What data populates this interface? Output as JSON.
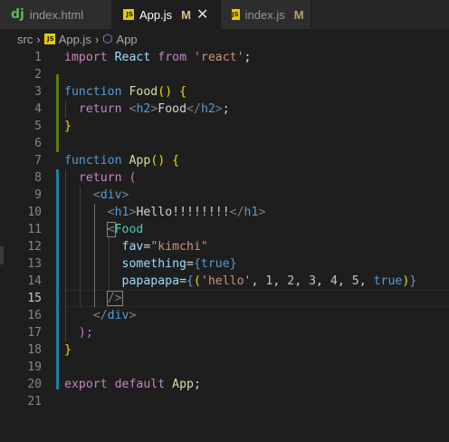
{
  "tabs": [
    {
      "name": "index.html",
      "icon": "django-icon",
      "modified": "",
      "active": false
    },
    {
      "name": "App.js",
      "icon": "javascript-icon",
      "modified": "M",
      "active": true
    },
    {
      "name": "index.js",
      "icon": "javascript-icon",
      "modified": "M",
      "active": false
    }
  ],
  "breadcrumb": {
    "folder": "src",
    "file": "App.js",
    "symbol": "App"
  },
  "lines": [
    "1",
    "2",
    "3",
    "4",
    "5",
    "6",
    "7",
    "8",
    "9",
    "10",
    "11",
    "12",
    "13",
    "14",
    "15",
    "16",
    "17",
    "18",
    "19",
    "20",
    "21"
  ],
  "current_line": "15",
  "code": {
    "l1": {
      "a": "import",
      "b": "React",
      "c": "from",
      "d": "'react'",
      "e": ";"
    },
    "l3": {
      "a": "function",
      "b": "Food",
      "c": "()",
      "d": "{"
    },
    "l4": {
      "a": "return",
      "b": "<",
      "c": "h2",
      "d": ">",
      "e": "Food",
      "f": "</",
      "g": "h2",
      "h": ">",
      "i": ";"
    },
    "l5": {
      "a": "}"
    },
    "l7": {
      "a": "function",
      "b": "App",
      "c": "()",
      "d": "{"
    },
    "l8": {
      "a": "return",
      "b": "("
    },
    "l9": {
      "a": "<",
      "b": "div",
      "c": ">"
    },
    "l10": {
      "a": "<",
      "b": "h1",
      "c": ">",
      "d": "Hello!!!!!!!!",
      "e": "</",
      "f": "h1",
      "g": ">"
    },
    "l11": {
      "a": "<",
      "b": "Food"
    },
    "l12": {
      "a": "fav",
      "b": "=",
      "c": "\"kimchi\""
    },
    "l13": {
      "a": "something",
      "b": "=",
      "c": "{",
      "d": "true",
      "e": "}"
    },
    "l14": {
      "a": "papapapa",
      "b": "=",
      "c": "{",
      "d": "(",
      "e": "'hello'",
      "f": ", ",
      "g": "1",
      "h": ", ",
      "i": "2",
      "j": ", ",
      "k": "3",
      "l": ", ",
      "m": "4",
      "n": ", ",
      "o": "5",
      "p": ", ",
      "q": "true",
      "r": ")",
      "s": "}"
    },
    "l15": {
      "a": "/>"
    },
    "l16": {
      "a": "</",
      "b": "div",
      "c": ">"
    },
    "l17": {
      "a": ");"
    },
    "l18": {
      "a": "}"
    },
    "l20": {
      "a": "export",
      "b": "default",
      "c": "App",
      "d": ";"
    }
  },
  "colors": {
    "modified": "#e2c08d",
    "git_added": "#587c0c",
    "git_modified": "#1b81a8",
    "background": "#1e1e1e"
  }
}
